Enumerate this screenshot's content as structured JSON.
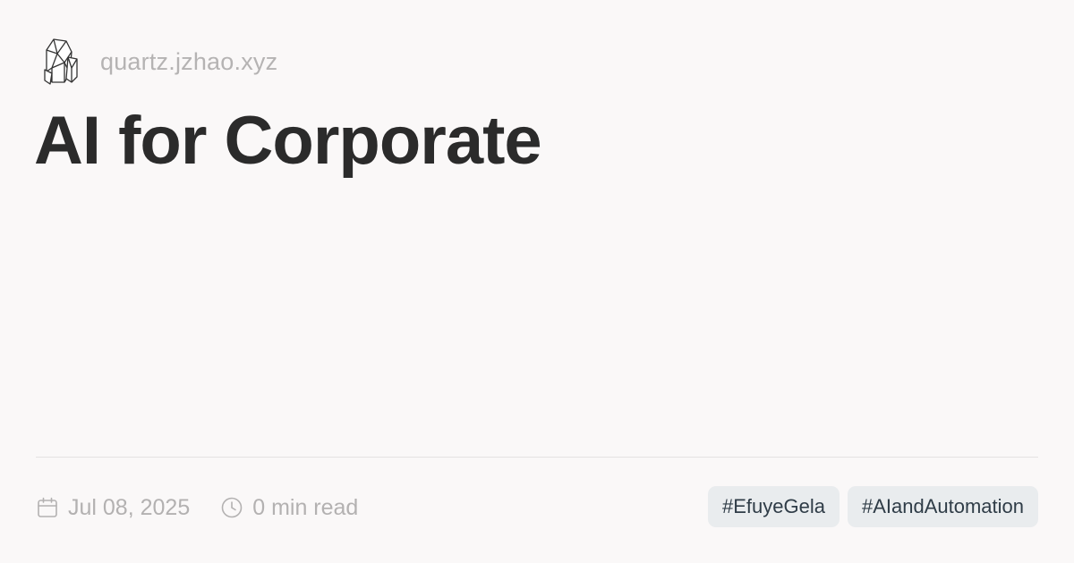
{
  "header": {
    "logo_icon": "crystal-logo-icon",
    "site_name": "quartz.jzhao.xyz"
  },
  "title": "AI for Corporate",
  "meta": {
    "date_icon": "calendar-icon",
    "date": "Jul 08, 2025",
    "read_time_icon": "clock-icon",
    "read_time": "0 min read"
  },
  "tags": [
    "#EfuyeGela",
    "#AIandAutomation"
  ],
  "colors": {
    "background": "#faf8f8",
    "title": "#2b2b2b",
    "muted_text": "#b3b1b1",
    "tag_background": "#e9ecee",
    "tag_text": "#2f3c47"
  }
}
